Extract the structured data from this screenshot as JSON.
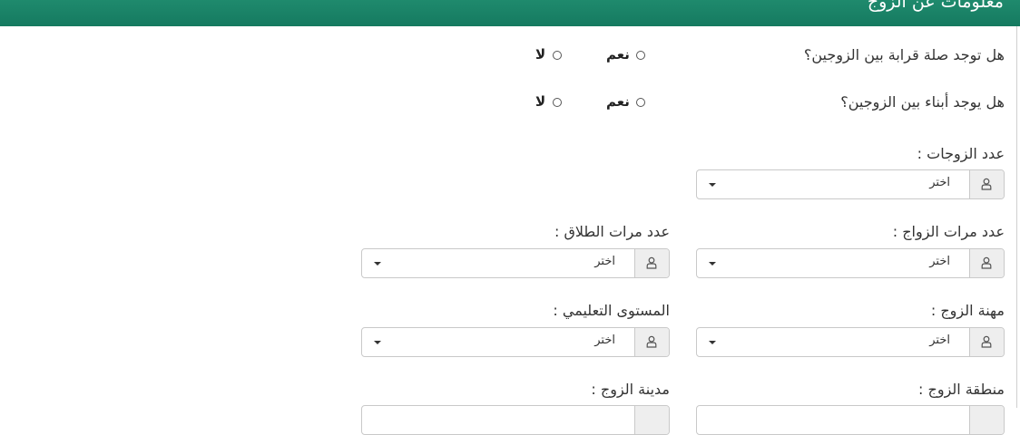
{
  "header": {
    "title": "معلومات عن الزوج"
  },
  "questions": [
    {
      "label": "هل توجد صلة قرابة بين الزوجين؟",
      "yes": "نعم",
      "no": "لا"
    },
    {
      "label": "هل يوجد أبناء بين الزوجين؟",
      "yes": "نعم",
      "no": "لا"
    }
  ],
  "fields": {
    "wives_count": {
      "label": "عدد الزوجات :",
      "value": "اختر"
    },
    "marriages_count": {
      "label": "عدد مرات الزواج :",
      "value": "اختر"
    },
    "divorces_count": {
      "label": "عدد مرات الطلاق :",
      "value": "اختر"
    },
    "husband_job": {
      "label": "مهنة الزوج :",
      "value": "اختر"
    },
    "education_level": {
      "label": "المستوى التعليمي :",
      "value": "اختر"
    },
    "husband_region": {
      "label": "منطقة الزوج :"
    },
    "husband_city": {
      "label": "مدينة الزوج :"
    }
  },
  "icons": {
    "addon": "user-icon",
    "dropdown": "caret-down-icon",
    "radio": "radio-icon"
  },
  "colors": {
    "header": "#1a836a",
    "addon_bg": "#eeeeee",
    "border": "#c9c9c9"
  }
}
